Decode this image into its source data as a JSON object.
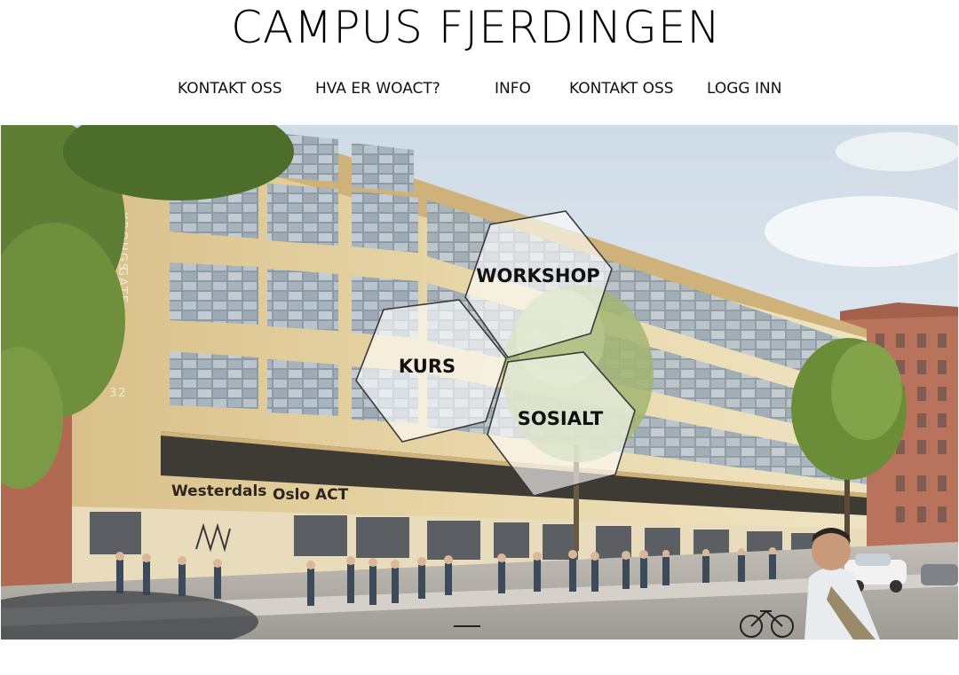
{
  "header": {
    "title": "CAMPUS FJERDINGEN"
  },
  "nav": {
    "items": [
      {
        "label": "KONTAKT OSS"
      },
      {
        "label": "HVA ER WOACT?"
      },
      {
        "label": "INFO"
      },
      {
        "label": "KONTAKT OSS"
      },
      {
        "label": "LOGG INN"
      }
    ]
  },
  "hero": {
    "signage": {
      "brand_main": "Westerdals",
      "brand_sub": "Oslo ACT",
      "street_name_line1": "KROHGS",
      "street_name_line2": "GATE",
      "street_number": "32"
    },
    "hexagons": [
      {
        "label": "WORKSHOP"
      },
      {
        "label": "KURS"
      },
      {
        "label": "SOSIALT"
      }
    ]
  },
  "colors": {
    "facade": "#e3cfa0",
    "facade_shadow": "#c9b07c",
    "window_frame": "#efe6cf",
    "window_glass": "#9aa7b3",
    "brick": "#b9735c",
    "sky": "#dfe9f1",
    "tree": "#6f8f3c",
    "pavement": "#b7b3ad",
    "hex_stroke": "#3a3a3a"
  }
}
